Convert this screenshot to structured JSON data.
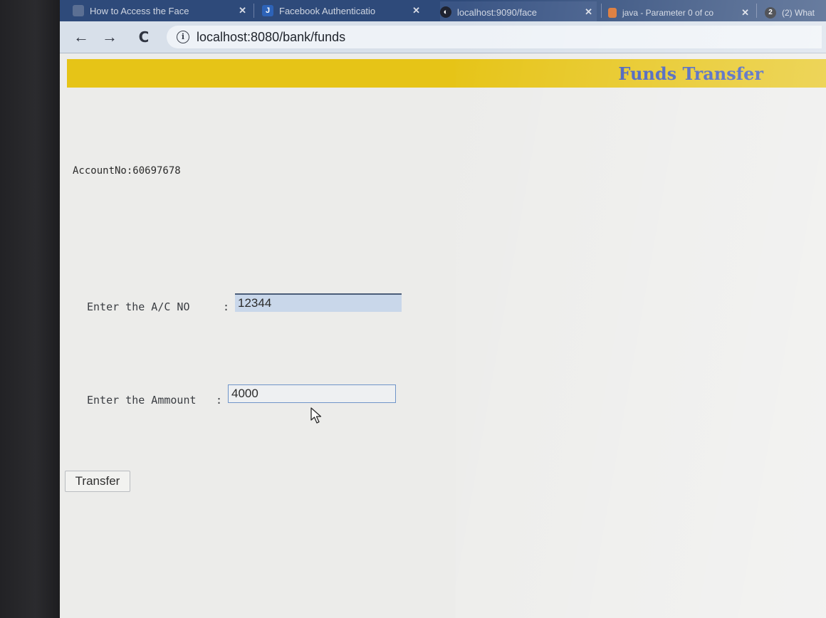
{
  "browser": {
    "tabs": [
      {
        "label": "How to Access the Face",
        "icon": "document-icon",
        "close": "✕"
      },
      {
        "label": "Facebook Authenticatio",
        "icon": "j-letter-icon",
        "close": "✕"
      },
      {
        "label": "localhost:9090/face",
        "icon": "globe-icon",
        "close": "✕"
      },
      {
        "label": "java - Parameter 0 of co",
        "icon": "stack-icon",
        "close": "✕"
      },
      {
        "label": "(2) What",
        "icon": "whatsapp-icon",
        "badge": "2"
      }
    ],
    "nav": {
      "back": "←",
      "forward": "→",
      "reload": "C"
    },
    "address": {
      "url": "localhost:8080/bank/funds",
      "info_icon": "i"
    }
  },
  "page": {
    "banner_title": "Funds Transfer",
    "banner_color": "#e6c417",
    "title_color": "#3b56b8",
    "account_line": "AccountNo:60697678",
    "form": {
      "acno_label": "Enter the A/C NO",
      "acno_colon": ":",
      "acno_value": "12344",
      "amount_label": "Enter the Ammount",
      "amount_colon": ":",
      "amount_value": "4000",
      "submit_label": "Transfer"
    }
  }
}
